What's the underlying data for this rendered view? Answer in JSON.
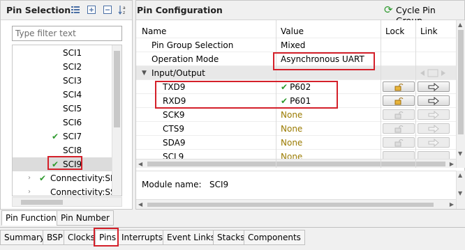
{
  "left_panel": {
    "title": "Pin Selection",
    "filter_placeholder": "Type filter text",
    "tree_items": [
      {
        "label": "SCI1",
        "checked": false
      },
      {
        "label": "SCI2",
        "checked": false
      },
      {
        "label": "SCI3",
        "checked": false
      },
      {
        "label": "SCI4",
        "checked": false
      },
      {
        "label": "SCI5",
        "checked": false
      },
      {
        "label": "SCI6",
        "checked": false
      },
      {
        "label": "SCI7",
        "checked": true
      },
      {
        "label": "SCI8",
        "checked": false
      },
      {
        "label": "SCI9",
        "checked": true,
        "selected": true
      },
      {
        "label": "Connectivity:SPI",
        "checked": true
      },
      {
        "label": "Connectivity:SSI",
        "checked": false
      }
    ]
  },
  "right_panel": {
    "title": "Pin Configuration",
    "cycle_label": "Cycle Pin Group",
    "columns": {
      "name": "Name",
      "value": "Value",
      "lock": "Lock",
      "link": "Link"
    },
    "rows": [
      {
        "name": "Pin Group Selection",
        "value": "Mixed"
      },
      {
        "name": "Operation Mode",
        "value": "Asynchronous UART"
      },
      {
        "name": "Input/Output",
        "value": ""
      },
      {
        "name": "TXD9",
        "value": "P602"
      },
      {
        "name": "RXD9",
        "value": "P601"
      },
      {
        "name": "SCK9",
        "value": "None"
      },
      {
        "name": "CTS9",
        "value": "None"
      },
      {
        "name": "SDA9",
        "value": "None"
      },
      {
        "name": "SCL9",
        "value": "None"
      }
    ],
    "module_label": "Module name:",
    "module_value": "SCI9"
  },
  "lower_tabs": [
    "Pin Function",
    "Pin Number"
  ],
  "bottom_tabs": [
    "Summary",
    "BSP",
    "Clocks",
    "Pins",
    "Interrupts",
    "Event Links",
    "Stacks",
    "Components"
  ],
  "colors": {
    "highlight": "#d4202a",
    "check": "#2e9a2e",
    "none_text": "#9a7a00"
  }
}
